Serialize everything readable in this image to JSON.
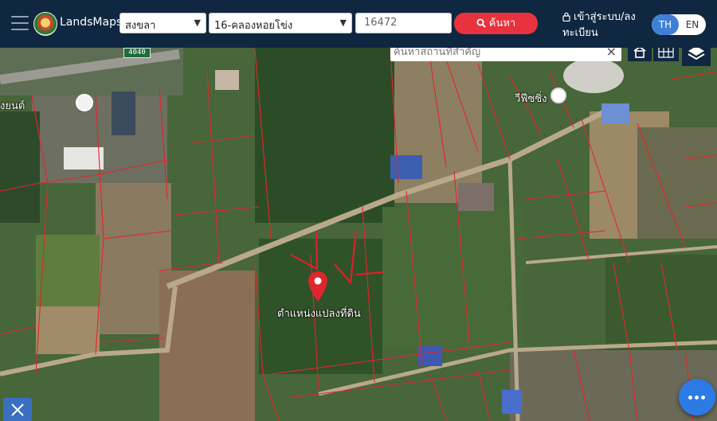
{
  "header": {
    "brand": "LandsMaps",
    "province": "สงขลา",
    "district": "16-คลองหอยโข่ง",
    "parcel_number": "16472",
    "search_label": "ค้นหา",
    "login_label": "เข้าสู่ระบบ/ลงทะเบียน",
    "lang_th": "TH",
    "lang_en": "EN",
    "active_lang": "TH"
  },
  "map": {
    "place_search_placeholder": "ค้นหาสถานที่สำคัญ",
    "road_number": "4040",
    "poi_labels": [
      "วีฟีซซิ่ง",
      "งยนต์"
    ],
    "pin_label": "ตำแหน่งแปลงที่ดิน",
    "parcel_line_color": "#e8242a"
  },
  "icons": {
    "menu": "hamburger-icon",
    "search": "magnifier-icon",
    "login": "lock-icon",
    "clear": "close-icon",
    "building": "building-icon",
    "grid": "grid-icon",
    "layers": "layers-icon",
    "tools": "tools-icon",
    "chat": "more-icon"
  }
}
